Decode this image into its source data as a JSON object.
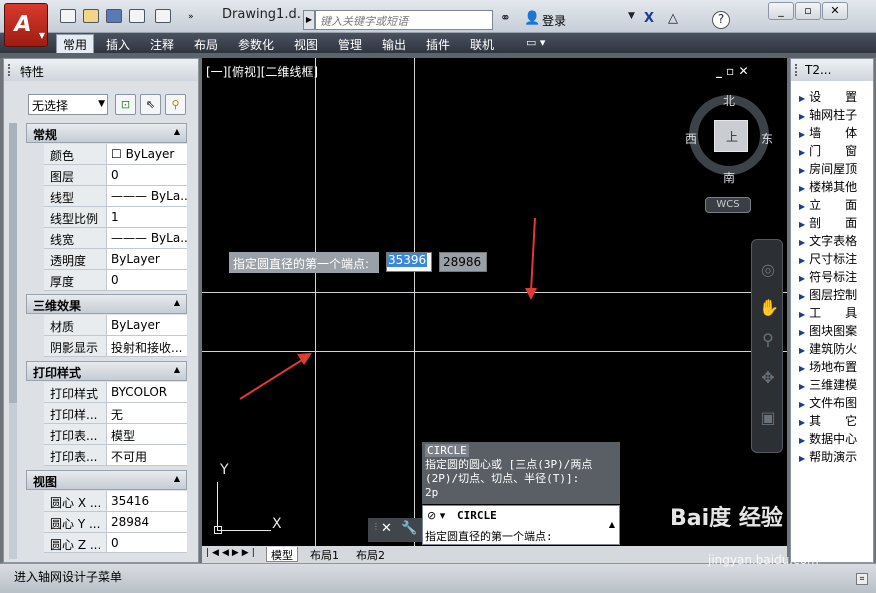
{
  "app": {
    "title": "Drawing1.d...",
    "search_placeholder": "键入关键字或短语",
    "login": "登录"
  },
  "menu": [
    "常用",
    "插入",
    "注释",
    "布局",
    "参数化",
    "视图",
    "管理",
    "输出",
    "插件",
    "联机"
  ],
  "props": {
    "title": "特性",
    "selection": "无选择",
    "sections": [
      {
        "name": "常规",
        "rows": [
          [
            "颜色",
            "☐ ByLayer"
          ],
          [
            "图层",
            "0"
          ],
          [
            "线型",
            "——— ByLa..."
          ],
          [
            "线型比例",
            "1"
          ],
          [
            "线宽",
            "——— ByLa..."
          ],
          [
            "透明度",
            "ByLayer"
          ],
          [
            "厚度",
            "0"
          ]
        ]
      },
      {
        "name": "三维效果",
        "rows": [
          [
            "材质",
            "ByLayer"
          ],
          [
            "阴影显示",
            "投射和接收..."
          ]
        ]
      },
      {
        "name": "打印样式",
        "rows": [
          [
            "打印样式",
            "BYCOLOR"
          ],
          [
            "打印样...",
            "无"
          ],
          [
            "打印表...",
            "模型"
          ],
          [
            "打印表...",
            "不可用"
          ]
        ]
      },
      {
        "name": "视图",
        "rows": [
          [
            "圆心 X ...",
            "35416"
          ],
          [
            "圆心 Y ...",
            "28984"
          ],
          [
            "圆心 Z ...",
            "0"
          ]
        ]
      }
    ]
  },
  "viewport": {
    "label": "[一][俯视][二维线框]",
    "compass": {
      "n": "北",
      "s": "南",
      "e": "东",
      "w": "西",
      "top": "上"
    },
    "wcs": "WCS",
    "ctrl": "_ ▫ ✕"
  },
  "input": {
    "prompt": "指定圆直径的第一个端点:",
    "x": "35396",
    "y": "28986"
  },
  "command": {
    "name": "CIRCLE",
    "history": "指定圆的圆心或 [三点(3P)/两点(2P)/切点、切点、半径(T)]:",
    "history2": "2p",
    "current": "CIRCLE",
    "current_prompt": "指定圆直径的第一个端点:"
  },
  "layout_tabs": [
    "模型",
    "布局1",
    "布局2"
  ],
  "t2": {
    "title": "T2...",
    "items": [
      "设　　置",
      "轴网柱子",
      "墙　　体",
      "门　　窗",
      "房间屋顶",
      "楼梯其他",
      "立　　面",
      "剖　　面",
      "文字表格",
      "尺寸标注",
      "符号标注",
      "图层控制",
      "工　　具",
      "图块图案",
      "建筑防火",
      "场地布置",
      "三维建模",
      "文件布图",
      "其　　它",
      "数据中心",
      "帮助演示"
    ]
  },
  "status": "进入轴网设计子菜单",
  "watermark": {
    "brand": "Bai度 经验",
    "url": "jingyan.baidu.com"
  },
  "colors": {
    "menubar": "#2f353f",
    "canvas": "#000000",
    "arrow": "#e03a35",
    "selected": "#3b87d8"
  }
}
